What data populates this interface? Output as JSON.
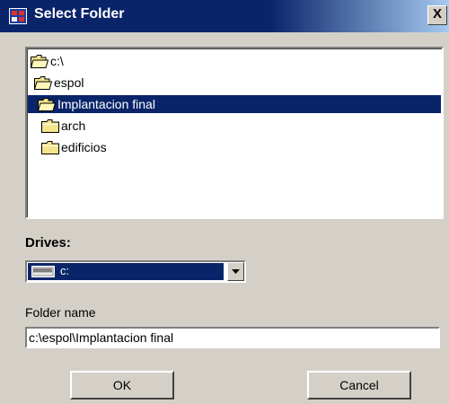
{
  "window": {
    "title": "Select Folder",
    "close_label": "X"
  },
  "tree": {
    "items": [
      {
        "label": "c:\\",
        "level": 0,
        "icon": "open-folder-icon",
        "selected": false
      },
      {
        "label": "espol",
        "level": 1,
        "icon": "open-folder-icon",
        "selected": false
      },
      {
        "label": "Implantacion final",
        "level": 2,
        "icon": "open-folder-icon",
        "selected": true
      },
      {
        "label": "arch",
        "level": 3,
        "icon": "folder-icon",
        "selected": false
      },
      {
        "label": "edificios",
        "level": 3,
        "icon": "folder-icon",
        "selected": false
      }
    ]
  },
  "drives": {
    "label": "Drives:",
    "selected": "c:",
    "icon": "hard-drive-icon"
  },
  "folder_name": {
    "label": "Folder name",
    "value": "c:\\espol\\Implantacion final"
  },
  "buttons": {
    "ok": "OK",
    "cancel": "Cancel"
  },
  "colors": {
    "titlebar": "#0a246a",
    "selection": "#0a246a",
    "dialog_bg": "#d4d0c8"
  }
}
